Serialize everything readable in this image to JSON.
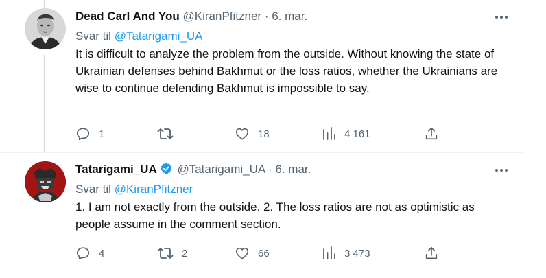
{
  "tweets": [
    {
      "name": "Dead Carl And You",
      "handle": "@KiranPfitzner",
      "dot": "·",
      "date": "6. mar.",
      "verified": false,
      "reply_prefix": "Svar til",
      "reply_to": "@Tatarigami_UA",
      "text": "It is difficult to analyze the problem from the outside. Without knowing the state of Ukrainian defenses behind Bakhmut or the loss ratios, whether the Ukrainians are wise to continue defending Bakhmut is impossible to say.",
      "replies": "1",
      "retweets": "",
      "likes": "18",
      "views": "4 161"
    },
    {
      "name": "Tatarigami_UA",
      "handle": "@Tatarigami_UA",
      "dot": "·",
      "date": "6. mar.",
      "verified": true,
      "reply_prefix": "Svar til",
      "reply_to": "@KiranPfitzner",
      "text": "1. I am not exactly from the outside.  2. The loss ratios are not as optimistic as people assume in the comment section.",
      "replies": "4",
      "retweets": "2",
      "likes": "66",
      "views": "3 473"
    }
  ],
  "icons": {
    "more": "more-icon",
    "reply": "reply-icon",
    "retweet": "retweet-icon",
    "like": "like-icon",
    "views": "views-icon",
    "share": "share-icon",
    "verified": "verified-badge-icon"
  },
  "colors": {
    "link": "#1d9bf0",
    "secondary_text": "#536471",
    "primary_text": "#0f1419",
    "verified": "#1d9bf0"
  }
}
